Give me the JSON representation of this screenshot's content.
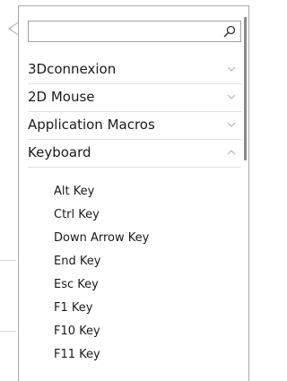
{
  "search": {
    "value": "",
    "placeholder": ""
  },
  "categories": [
    {
      "label": "3Dconnexion",
      "state": "collapsed",
      "chevron": "chevron-down-icon"
    },
    {
      "label": "2D Mouse",
      "state": "collapsed",
      "chevron": "chevron-down-icon"
    },
    {
      "label": "Application Macros",
      "state": "collapsed",
      "chevron": "chevron-down-icon"
    },
    {
      "label": "Keyboard",
      "state": "expanded",
      "chevron": "chevron-up-icon"
    }
  ],
  "keyboard_items": [
    {
      "label": "Alt Key"
    },
    {
      "label": "Ctrl Key"
    },
    {
      "label": "Down Arrow Key"
    },
    {
      "label": "End Key"
    },
    {
      "label": "Esc Key"
    },
    {
      "label": "F1 Key"
    },
    {
      "label": "F10 Key"
    },
    {
      "label": "F11 Key"
    }
  ],
  "colors": {
    "border": "#a8a8a8",
    "divider": "#e1e1e1",
    "text": "#1a1a1a",
    "chevron": "#b0b0b0",
    "scrollbar": "#8a8a8a"
  }
}
